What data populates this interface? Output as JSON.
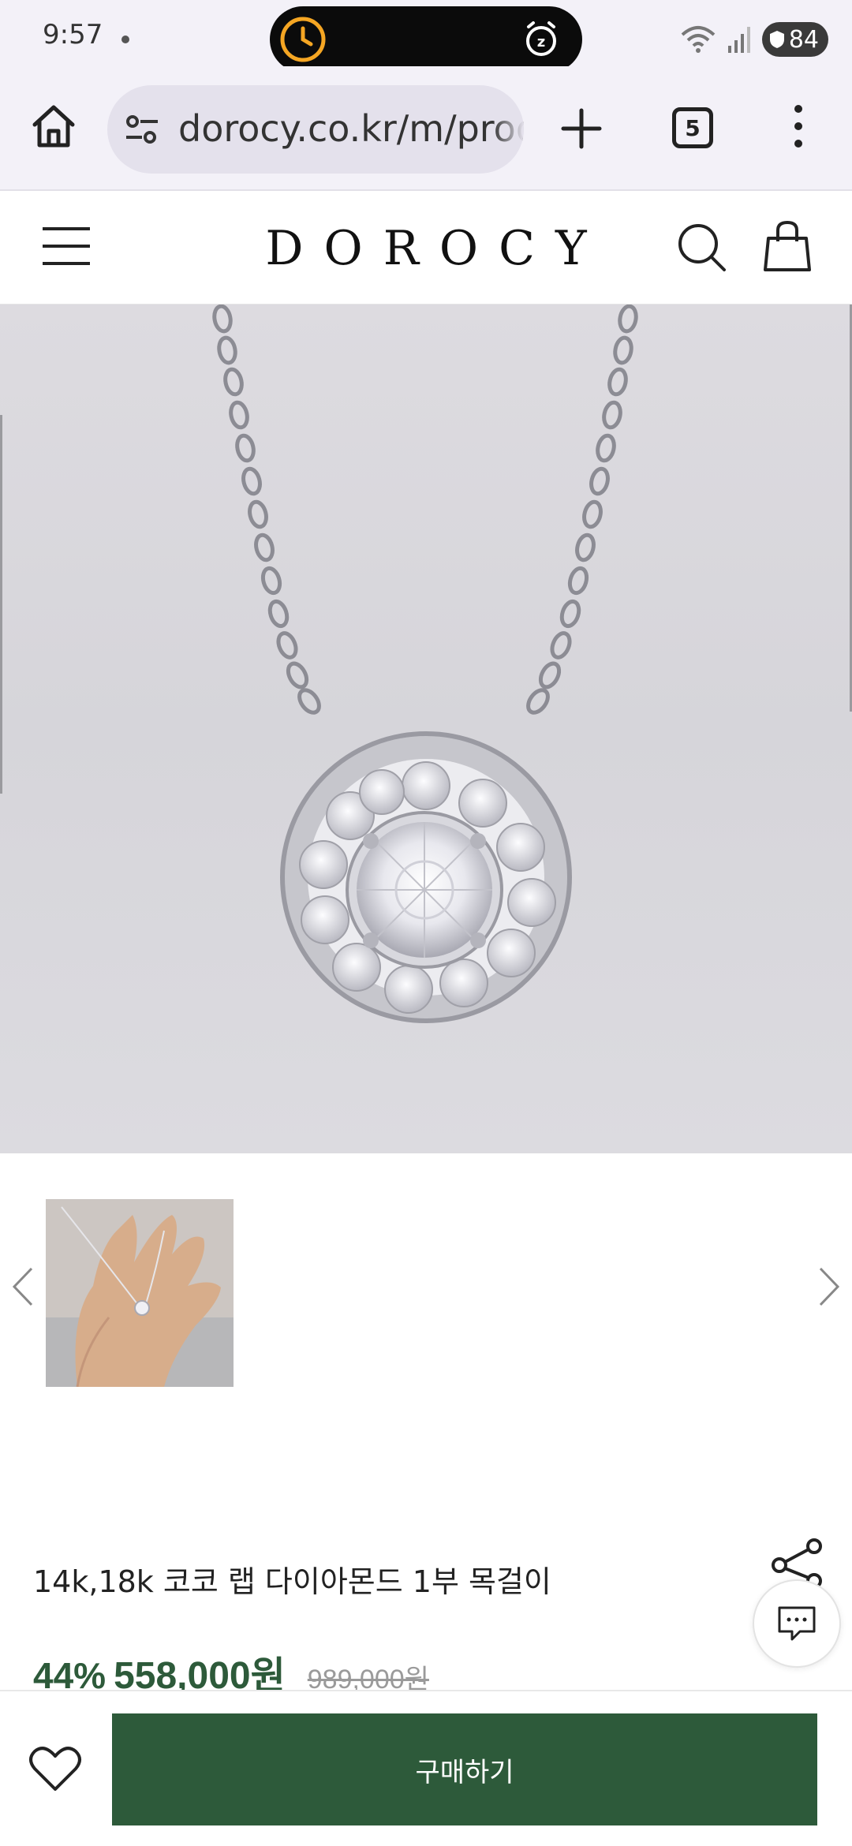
{
  "status_bar": {
    "time": "9:57",
    "battery": "84"
  },
  "browser": {
    "url": "dorocy.co.kr/m/product",
    "tab_count": "5"
  },
  "site": {
    "logo": "DOROCY"
  },
  "product": {
    "title": "14k,18k 코코 랩 다이아몬드 1부 목걸이",
    "discount": "44%",
    "price": "558,000원",
    "original_price": "989,000원"
  },
  "actions": {
    "buy_label": "구매하기"
  },
  "icons": {
    "home": "home-icon",
    "tune": "site-settings-icon",
    "plus": "new-tab-icon",
    "menu": "more-vert-icon",
    "hamburger": "menu-icon",
    "search": "search-icon",
    "bag": "shopping-bag-icon",
    "share": "share-icon",
    "chat": "chat-icon",
    "heart": "heart-icon"
  },
  "colors": {
    "brand_green": "#2d5a3a",
    "browser_bg": "#f3f1f8",
    "url_bg": "#e4e1ec"
  }
}
